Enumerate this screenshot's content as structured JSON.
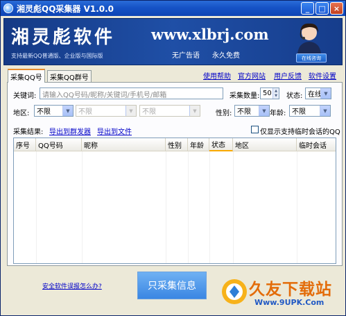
{
  "window": {
    "title": "湘灵彪QQ采集器 V1.0.0",
    "controls": {
      "minimize": "_",
      "maximize": "□",
      "close": "×"
    }
  },
  "banner": {
    "brand": "湘灵彪软件",
    "subtitle": "支持最新QQ普通版、企业版与国际版",
    "url": "www.xlbrj.com",
    "slogan_left": "无广告语",
    "slogan_right": "永久免费",
    "online_label": "在线咨询"
  },
  "tabs": [
    {
      "label": "采集QQ号"
    },
    {
      "label": "采集QQ群号"
    }
  ],
  "top_links": {
    "help": "使用帮助",
    "website": "官方网站",
    "feedback": "用户反馈",
    "settings": "软件设置"
  },
  "form": {
    "keyword_label": "关键词:",
    "keyword_placeholder": "请输入QQ号码/昵称/关键词/手机号/邮箱",
    "count_label": "采集数量:",
    "count_value": "50",
    "status_label": "状态:",
    "status_value": "在线",
    "region_label": "地区:",
    "region1_value": "不限",
    "region2_value": "不限",
    "region3_value": "不限",
    "gender_label": "性别:",
    "gender_value": "不限",
    "age_label": "年龄:",
    "age_value": "不限",
    "results_label": "采集结果:",
    "export_sender": "导出到群发器",
    "export_file": "导出到文件",
    "only_temp_label": "仅显示支持临时会话的QQ"
  },
  "grid": {
    "columns": [
      "序号",
      "QQ号码",
      "昵称",
      "性别",
      "年龄",
      "状态",
      "地区",
      "临时会话"
    ]
  },
  "footer": {
    "report_link": "安全软件误报怎么办?",
    "collect_button": "只采集信息"
  },
  "watermark": {
    "title": "久友下载站",
    "url": "Www.9UPK.Com"
  },
  "colors": {
    "titlebar": "#1653c6",
    "banner": "#1f4fa6",
    "link": "#0000c8",
    "tab_accent": "#e68b2c",
    "watermark_title": "#e36c0a"
  }
}
